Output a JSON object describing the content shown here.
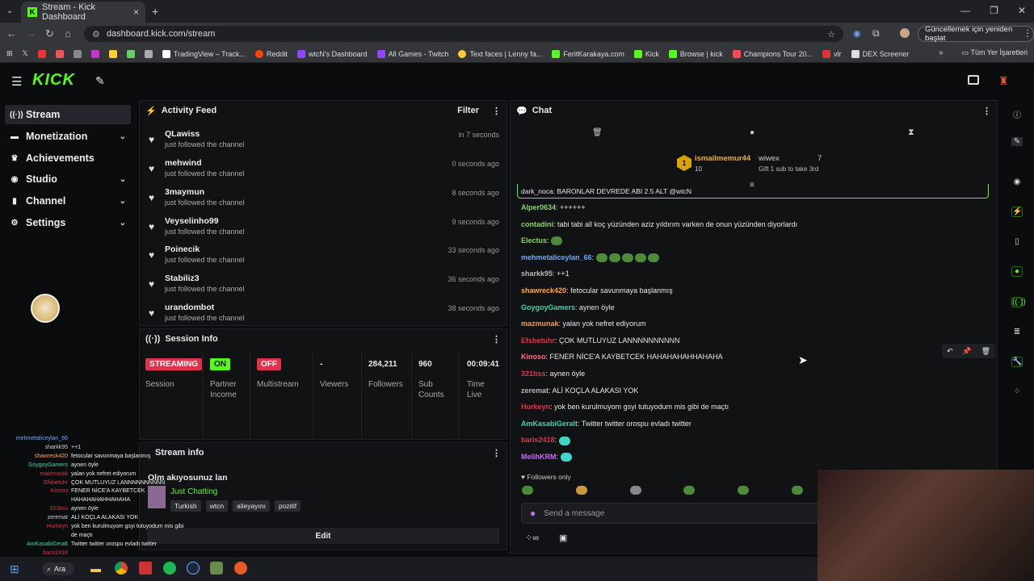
{
  "browser": {
    "tab_title": "Stream - Kick Dashboard",
    "url": "dashboard.kick.com/stream",
    "update_button": "Güncellemek için yeniden başlat",
    "bookmarks": [
      "TradingView – Track...",
      "Reddit",
      "wtcN's Dashboard",
      "All Games - Twitch",
      "Text faces | Lenny fa...",
      "FeritKarakaya.com",
      "Kick",
      "Browse | kick",
      "Champions Tour 20...",
      "vlr",
      "DEX Screener"
    ],
    "all_bookmarks": "Tüm Yer İşaretleri"
  },
  "header": {
    "logo": "KICK"
  },
  "sidebar": {
    "items": [
      {
        "label": "Stream",
        "icon": "broadcast-icon"
      },
      {
        "label": "Monetization",
        "icon": "dollar-icon"
      },
      {
        "label": "Achievements",
        "icon": "trophy-icon"
      },
      {
        "label": "Studio",
        "icon": "studio-icon"
      },
      {
        "label": "Channel",
        "icon": "channel-icon"
      },
      {
        "label": "Settings",
        "icon": "gear-icon"
      }
    ]
  },
  "activity": {
    "title": "Activity Feed",
    "filter": "Filter",
    "items": [
      {
        "name": "QLawiss",
        "action": "just followed the channel",
        "time": "in 7 seconds"
      },
      {
        "name": "mehwind",
        "action": "just followed the channel",
        "time": "0 seconds ago"
      },
      {
        "name": "3maymun",
        "action": "just followed the channel",
        "time": "8 seconds ago"
      },
      {
        "name": "Veyselinho99",
        "action": "just followed the channel",
        "time": "9 seconds ago"
      },
      {
        "name": "Poinecik",
        "action": "just followed the channel",
        "time": "33 seconds ago"
      },
      {
        "name": "Stabiliz3",
        "action": "just followed the channel",
        "time": "36 seconds ago"
      },
      {
        "name": "urandombot",
        "action": "just followed the channel",
        "time": "38 seconds ago"
      }
    ]
  },
  "session": {
    "title": "Session Info",
    "streaming": "STREAMING",
    "session_label": "Session",
    "partner_badge": "ON",
    "partner_label1": "Partner",
    "partner_label2": "Income",
    "multi_badge": "OFF",
    "multi_label": "Multistream",
    "viewers_value": "-",
    "viewers_label": "Viewers",
    "followers_value": "284,211",
    "followers_label": "Followers",
    "subs_value": "960",
    "subs_label1": "Sub",
    "subs_label2": "Counts",
    "time_value": "00:09:41",
    "time_label1": "Time",
    "time_label2": "Live"
  },
  "streaminfo": {
    "title": "Stream info",
    "stream_title": "Olm akıyosunuz lan",
    "category": "Just Chatting",
    "tags": [
      "Turkish",
      "wtcn",
      "aileyayını",
      "pozitif"
    ],
    "edit": "Edit"
  },
  "chat": {
    "title": "Chat",
    "pinned_user": "ismailmemur44",
    "pinned_rank": "1",
    "pinned_count": "10",
    "gift_user": "wiwex",
    "gift_count": "7",
    "gift_text": "Gift 1 sub to take 3rd",
    "truncated": "dark_noca: BARONLAR DEVREDE ABI 2.5 ALT @wtcN",
    "messages": [
      {
        "user": "Alper0634",
        "color": "#8bd36a",
        "text": "++++++"
      },
      {
        "user": "contadini",
        "color": "#8bd36a",
        "text": "tabi tabi all koç yüzünden aziz yıldırım varken de onun yüzünden diyorlardı"
      },
      {
        "user": "Electus",
        "color": "#8bd36a",
        "text": ""
      },
      {
        "user": "mehmetaliceylan_66",
        "color": "#6fa8ff",
        "text": ""
      },
      {
        "user": "sharkk95",
        "color": "#b8b8b8",
        "text": "++1"
      },
      {
        "user": "shawreck420",
        "color": "#ffa64d",
        "text": "fetocular savunmaya başlanmış"
      },
      {
        "user": "GoygoyGamers",
        "color": "#3ed6a6",
        "text": "aynen öyle"
      },
      {
        "user": "mazmunak",
        "color": "#ff9a3d",
        "text": "yalan yok nefret ediyorum"
      },
      {
        "user": "Efsbetuhr",
        "color": "#e0314a",
        "text": "ÇOK MUTLUYUZ LANNNNNNNNNN"
      },
      {
        "user": "Kinoso",
        "color": "#ff6e8a",
        "text": "FENER NİCE'A KAYBETCEK HAHAHAHAHHAHAHA"
      },
      {
        "user": "321bss",
        "color": "#e0314a",
        "text": "aynen öyle"
      },
      {
        "user": "zeremat",
        "color": "#b8b8b8",
        "text": "ALİ KOÇLA ALAKASI YOK"
      },
      {
        "user": "Hurkeyn",
        "color": "#e0314a",
        "text": "yok ben kurulmuyom gsyi tutuyodum mis gibi de maçtı"
      },
      {
        "user": "AmKasabiGeralt",
        "color": "#3ed6a6",
        "text": "Twitter twitter orospu evladı twitter"
      },
      {
        "user": "baris2418",
        "color": "#e0314a",
        "text": ""
      },
      {
        "user": "MelihKRM",
        "color": "#c76bff",
        "text": ""
      }
    ],
    "followers_only": "Followers only",
    "placeholder": "Send a message"
  },
  "overlay": {
    "lines": [
      {
        "user": "mehmetaliceylan_66",
        "text": ""
      },
      {
        "user": "sharkk95",
        "text": "++1"
      },
      {
        "user": "shawreck420",
        "text": "fetocular savunmaya başlanmış"
      },
      {
        "user": "GoygoyGamers",
        "text": "aynen öyle"
      },
      {
        "user": "mazmunak",
        "text": "yalan yok nefret ediyorum"
      },
      {
        "user": "Efsbetuhr",
        "text": "ÇOK MUTLUYUZ LANNNNNNNNNN"
      },
      {
        "user": "Kinoso",
        "text": "FENER NİCE'A KAYBETCEK"
      },
      {
        "user": "",
        "text": "HAHAHAHAHHAHAHA"
      },
      {
        "user": "321bss",
        "text": "aynen öyle"
      },
      {
        "user": "zeremat",
        "text": "ALİ KOÇLA ALAKASI YOK"
      },
      {
        "user": "Hurkeyn",
        "text": "yok ben kurulmuyom gsyi tutuyodum mis gibi"
      },
      {
        "user": "",
        "text": "de maçtı"
      },
      {
        "user": "AmKasabiGeralt",
        "text": "Twitter twitter orospu evladı twitter"
      },
      {
        "user": "baris2418",
        "text": ""
      },
      {
        "user": "MelihKRM",
        "text": ""
      }
    ]
  },
  "taskbar": {
    "search": "Ara"
  },
  "colors": {
    "kick_green": "#53fc18",
    "panel": "#111214",
    "streaming_red": "#e0314a"
  }
}
